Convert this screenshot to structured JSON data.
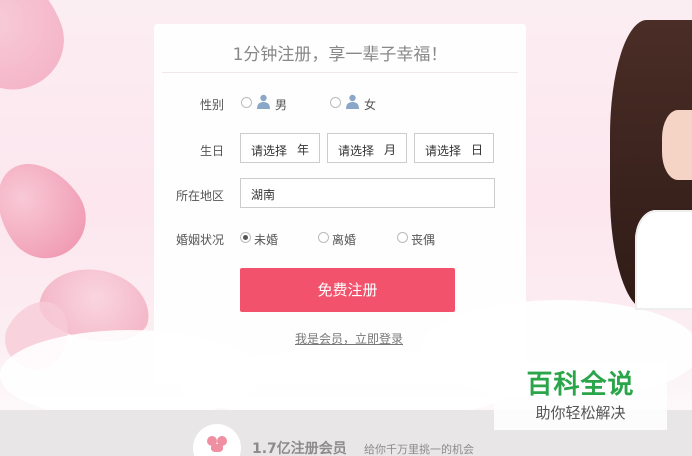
{
  "form": {
    "title": "1分钟注册，享一辈子幸福！",
    "gender": {
      "label": "性别",
      "options": [
        "男",
        "女"
      ]
    },
    "birthday": {
      "label": "生日",
      "year": {
        "placeholder": "请选择",
        "unit": "年"
      },
      "month": {
        "placeholder": "请选择",
        "unit": "月"
      },
      "day": {
        "placeholder": "请选择",
        "unit": "日"
      }
    },
    "region": {
      "label": "所在地区",
      "value": "湖南"
    },
    "marital": {
      "label": "婚姻状况",
      "options": [
        "未婚",
        "离婚",
        "丧偶"
      ],
      "selected": "未婚"
    },
    "submit_label": "免费注册",
    "login_link": "我是会员，立即登录"
  },
  "footer": {
    "member_count": "1.7亿注册会员",
    "tagline": "给你千万里挑一的机会"
  },
  "watermark": {
    "title": "百科全说",
    "subtitle": "助你轻松解决"
  },
  "colors": {
    "accent": "#f2526b",
    "watermark": "#2aa54a"
  }
}
